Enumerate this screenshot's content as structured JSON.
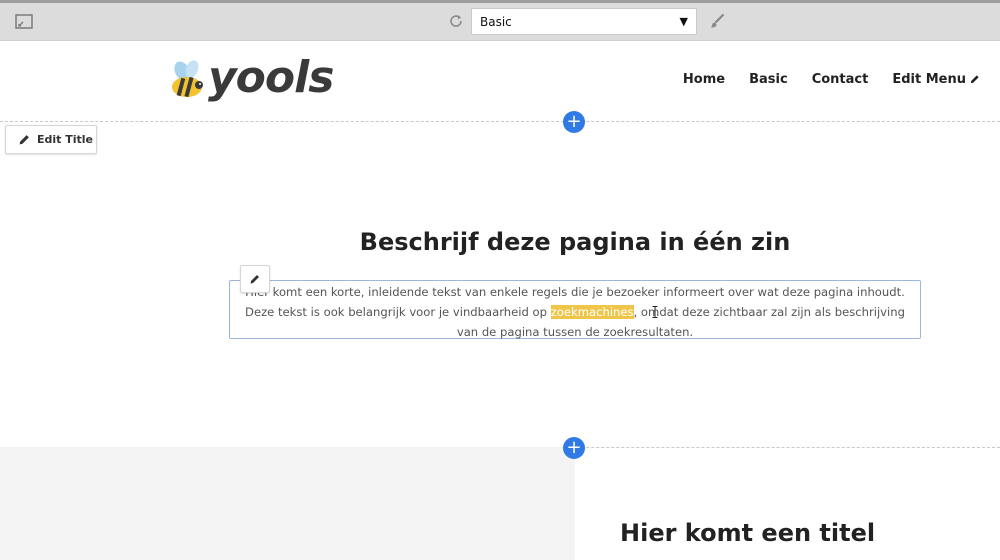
{
  "toolbar": {
    "template_select": {
      "selected": "Basic"
    }
  },
  "header": {
    "logo_text": "yools",
    "nav": [
      {
        "label": "Home"
      },
      {
        "label": "Basic"
      },
      {
        "label": "Contact"
      },
      {
        "label": "Edit Menu"
      }
    ]
  },
  "editor": {
    "edit_title_label": "Edit Title",
    "add_section_symbol": "+"
  },
  "hero": {
    "title": "Beschrijf deze pagina in één zin",
    "text_before": "Hier komt een korte, inleidende tekst van enkele regels die je bezoeker informeert over wat deze pagina inhoudt. Deze tekst is ook belangrijk voor je vindbaarheid op ",
    "text_highlight": "zoekmachines",
    "text_after": ", omdat deze zichtbaar zal zijn als beschrijving van de pagina tussen de zoekresultaten."
  },
  "section2": {
    "title": "Hier komt een titel"
  },
  "colors": {
    "accent_blue": "#2f7ae5",
    "highlight_yellow": "#f0c64a",
    "toolbar_bg": "#dcdcdc"
  }
}
